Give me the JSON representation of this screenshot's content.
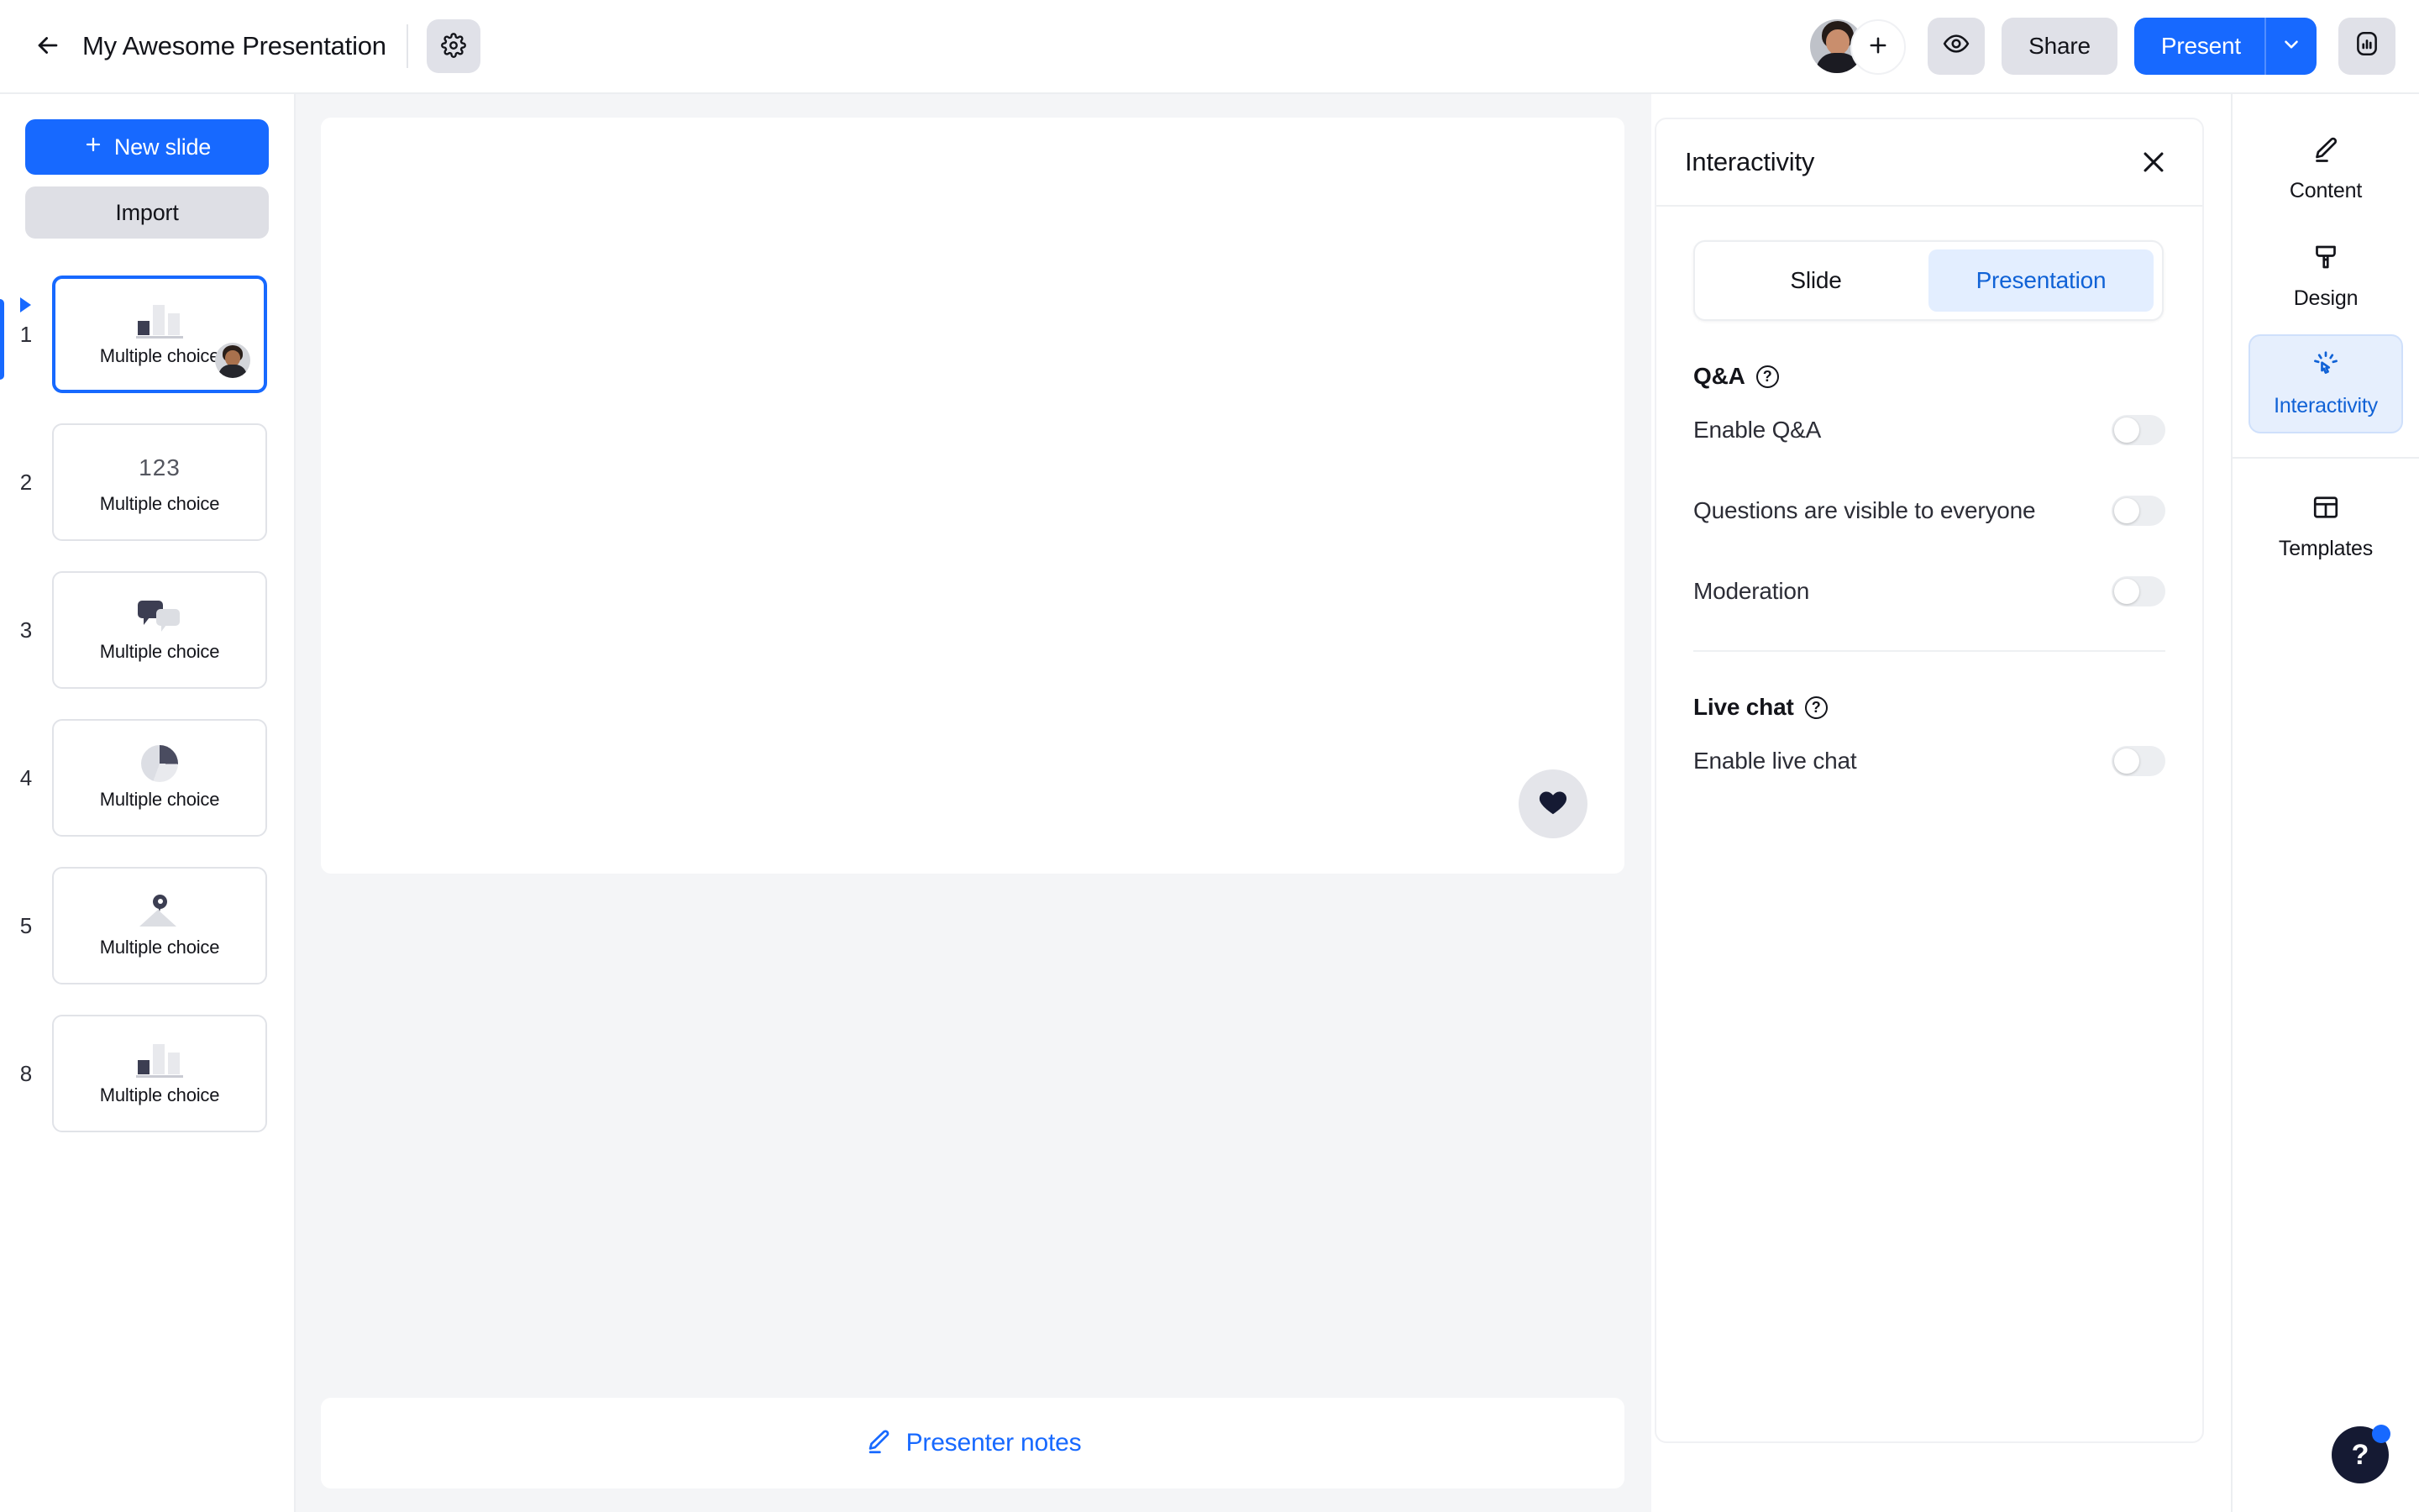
{
  "topbar": {
    "back_icon": "arrow-left-icon",
    "title": "My Awesome Presentation",
    "settings_icon": "gear-icon",
    "avatar_name": "avatar",
    "add_person_icon": "plus-icon",
    "preview_icon": "eye-icon",
    "share_label": "Share",
    "present_label": "Present",
    "present_caret_icon": "chevron-down-icon",
    "analytics_icon": "bar-chart-icon"
  },
  "sidebar": {
    "new_slide_label": "New slide",
    "new_slide_icon": "plus-icon",
    "import_label": "Import",
    "slides": [
      {
        "number": "1",
        "label": "Multiple choice",
        "icon": "bar-chart-icon",
        "active": true,
        "has_avatar": true
      },
      {
        "number": "2",
        "label": "Multiple choice",
        "icon": "numbers-123-icon",
        "active": false,
        "has_avatar": false
      },
      {
        "number": "3",
        "label": "Multiple choice",
        "icon": "speech-bubbles-icon",
        "active": false,
        "has_avatar": false
      },
      {
        "number": "4",
        "label": "Multiple choice",
        "icon": "pie-chart-icon",
        "active": false,
        "has_avatar": false
      },
      {
        "number": "5",
        "label": "Multiple choice",
        "icon": "image-pin-icon",
        "active": false,
        "has_avatar": false
      },
      {
        "number": "8",
        "label": "Multiple choice",
        "icon": "bar-chart-icon",
        "active": false,
        "has_avatar": false
      }
    ]
  },
  "canvas": {
    "reaction_icon": "heart-icon",
    "notes_label": "Presenter notes",
    "notes_icon": "pencil-icon"
  },
  "panel": {
    "title": "Interactivity",
    "close_icon": "close-icon",
    "segments": [
      {
        "label": "Slide",
        "selected": false
      },
      {
        "label": "Presentation",
        "selected": true
      }
    ],
    "qa_section": {
      "title": "Q&A",
      "help_icon": "question-mark-icon",
      "rows": [
        {
          "label": "Enable Q&A",
          "on": false
        },
        {
          "label": "Questions are visible to everyone",
          "on": false
        },
        {
          "label": "Moderation",
          "on": false
        }
      ]
    },
    "chat_section": {
      "title": "Live chat",
      "help_icon": "question-mark-icon",
      "rows": [
        {
          "label": "Enable live chat",
          "on": false
        }
      ]
    }
  },
  "rail": {
    "items": [
      {
        "label": "Content",
        "icon": "pencil-icon",
        "active": false
      },
      {
        "label": "Design",
        "icon": "paintbrush-icon",
        "active": false
      },
      {
        "label": "Interactivity",
        "icon": "click-cursor-icon",
        "active": true
      }
    ],
    "footer_items": [
      {
        "label": "Templates",
        "icon": "table-grid-icon",
        "active": false
      }
    ]
  },
  "help_fab": {
    "glyph": "?",
    "icon": "help-icon"
  },
  "colors": {
    "accent": "#1769ff",
    "accent_soft": "#e3eeff",
    "accent_text": "#1062d6",
    "neutral_button": "#e0e1e8",
    "canvas_bg": "#f4f5f7",
    "dark": "#13141a",
    "fab_bg": "#151a33"
  }
}
